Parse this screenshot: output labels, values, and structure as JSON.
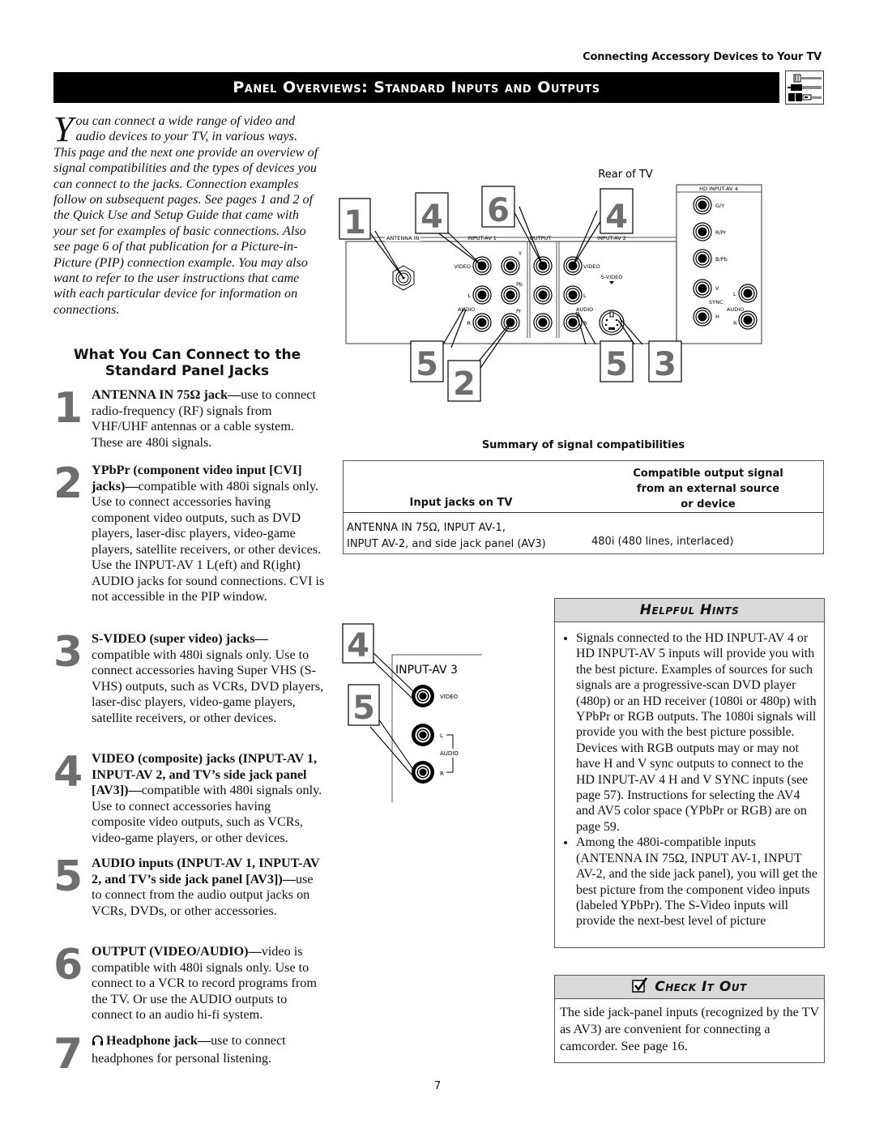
{
  "header": {
    "running_head": "Connecting Accessory Devices to Your TV",
    "title": "Panel Overviews: Standard Inputs and Outputs",
    "title_icon": "cable-connectors-icon"
  },
  "intro": {
    "dropcap": "Y",
    "text": "ou can connect a wide range of video and audio devices to your TV, in various ways. This page and the next one provide an overview of signal compatibilities and the types of devices you can connect to the jacks. Connection examples follow on subsequent pages. See pages 1 and 2 of the Quick Use and Setup Guide that came with your set for examples of basic connections. Also see page 6 of that publication for a Picture-in-Picture (PIP) connection example. You may also want to refer to the user instructions that came with each particular device for information on connections."
  },
  "subhead": {
    "line1": "What You Can Connect to the",
    "line2": "Standard Panel Jacks"
  },
  "items": [
    {
      "num": "1",
      "bold": "ANTENNA IN 75Ω jack—",
      "text": "use to connect radio-frequency (RF) signals from VHF/UHF antennas or a cable system. These are 480i signals."
    },
    {
      "num": "2",
      "bold": "YPbPr (component video input [CVI] jacks)—",
      "text": "compatible with 480i signals only. Use to connect accessories having component video outputs, such as DVD players, laser-disc players, video-game players, satellite receivers, or other devices. Use the INPUT-AV 1 L(eft) and R(ight) AUDIO jacks for sound connections. CVI is not accessible in the PIP window."
    },
    {
      "num": "3",
      "bold": "S-VIDEO (super video) jacks—",
      "text": "compatible with 480i signals only. Use to connect accessories having Super VHS (S-VHS) outputs, such as VCRs, DVD players, laser-disc players, video-game players, satellite receivers, or other devices."
    },
    {
      "num": "4",
      "bold": "VIDEO (composite) jacks (INPUT-AV 1, INPUT-AV 2, and TV’s side jack panel [AV3])—",
      "text": "compatible with 480i signals only. Use to connect accessories having composite video outputs, such as VCRs, video-game players, or other devices."
    },
    {
      "num": "5",
      "bold": "AUDIO inputs (INPUT-AV 1, INPUT-AV 2, and TV’s side jack panel [AV3])—",
      "text": "use to connect from the audio output jacks on VCRs, DVDs, or other accessories."
    },
    {
      "num": "6",
      "bold": "OUTPUT (VIDEO/AUDIO)—",
      "text": "video is compatible with 480i signals only. Use to connect to a VCR to record programs from the TV. Or use the AUDIO outputs to connect to an audio hi-fi system."
    },
    {
      "num": "7",
      "icon": "headphone-icon",
      "bold": "Headphone jack—",
      "text": "use to connect headphones for personal listening."
    }
  ],
  "rear_diagram": {
    "caption": "Rear of TV",
    "sections": {
      "antenna": "ANTENNA IN",
      "av1": "INPUT-AV 1",
      "output": "OUTPUT",
      "av2": "INPUT-AV 2",
      "av4": "HD INPUT-AV 4"
    },
    "labels": {
      "video": "VIDEO",
      "l": "L",
      "r": "R",
      "audio": "AUDIO",
      "y": "Y",
      "pb": "Pb",
      "pr": "Pr",
      "svideo": "S-VIDEO",
      "gy": "G/Y",
      "rpr": "R/Pr",
      "bpb": "B/Pb",
      "v": "V",
      "h": "H",
      "sync": "SYNC"
    },
    "callouts": [
      "1",
      "4",
      "6",
      "4",
      "5",
      "2",
      "5",
      "3"
    ]
  },
  "summary": {
    "title": "Summary of signal compatibilities",
    "col1_header": "Input jacks on TV",
    "col2_header_lines": [
      "Compatible output signal",
      "from an external source",
      "or device"
    ],
    "row_col1_lines": [
      "ANTENNA IN 75Ω, INPUT AV-1,",
      "INPUT AV-2, and side jack panel (AV3)"
    ],
    "row_col2": "480i (480 lines, interlaced)"
  },
  "side_diagram": {
    "title": "INPUT-AV 3",
    "labels": {
      "video": "VIDEO",
      "l": "L",
      "audio": "AUDIO",
      "r": "R"
    },
    "callouts": [
      "4",
      "5"
    ]
  },
  "hints": {
    "title": "Helpful Hints",
    "bullets": [
      "Signals connected to the HD INPUT-AV 4 or HD INPUT-AV 5 inputs will provide you with the best picture. Examples of sources for such signals are a progressive-scan DVD player (480p) or an HD receiver (1080i or 480p) with YPbPr or RGB outputs. The 1080i signals will provide you with the best picture possible. Devices with RGB outputs may or may not have H and V sync outputs to connect to the HD INPUT-AV 4 H and V SYNC inputs (see page 57). Instructions for selecting the AV4 and AV5 color space (YPbPr or RGB) are on page 59.",
      "Among the 480i-compatible inputs (ANTENNA IN 75Ω, INPUT AV-1, INPUT AV-2, and the side jack panel), you will get the best picture from the component video inputs (labeled YPbPr). The S-Video inputs will provide the next-best level of picture"
    ]
  },
  "check_it_out": {
    "title": "Check It Out",
    "text": "The side jack-panel inputs (recognized by the TV as AV3) are convenient for connecting a camcorder. See page 16."
  },
  "footer": {
    "page_number": "7"
  }
}
